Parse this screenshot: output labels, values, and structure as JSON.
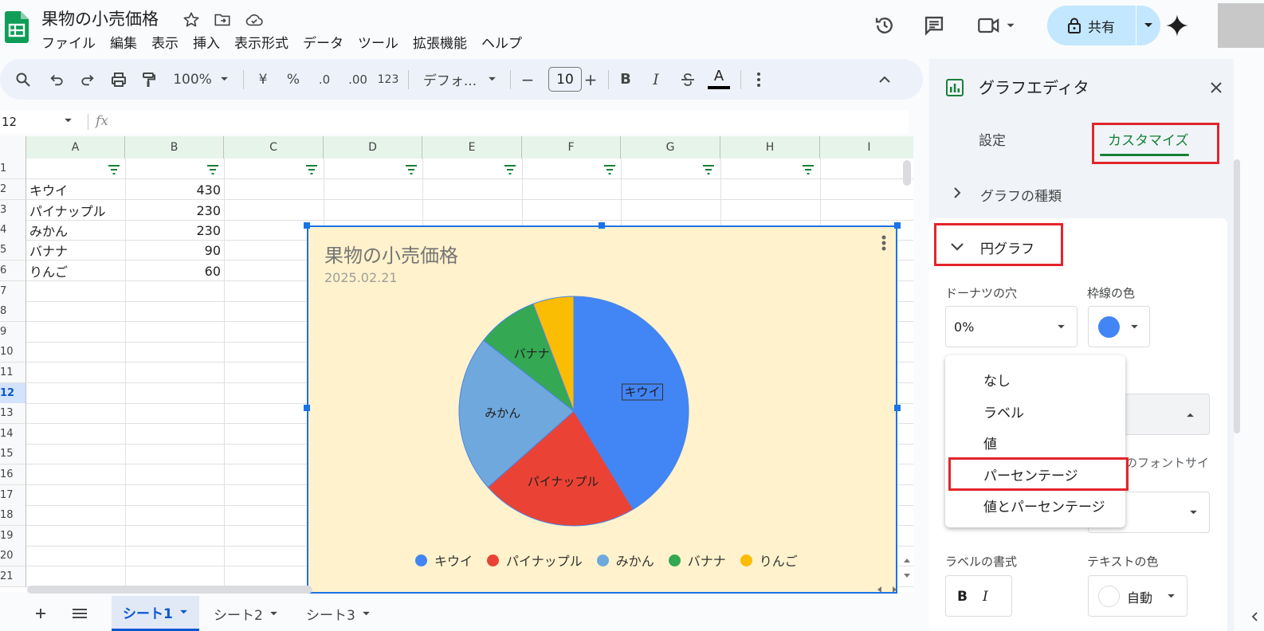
{
  "app": {
    "doc_title": "果物の小売価格",
    "menu": [
      "ファイル",
      "編集",
      "表示",
      "挿入",
      "表示形式",
      "データ",
      "ツール",
      "拡張機能",
      "ヘルプ"
    ],
    "share_label": "共有"
  },
  "toolbar": {
    "zoom": "100%",
    "currency": "¥",
    "percent": "%",
    "dec_decrease": ".0",
    "dec_increase": ".00",
    "number_format": "123",
    "font": "デフォ...",
    "font_size": "10",
    "minus": "−",
    "plus": "+",
    "bold": "B",
    "italic": "I",
    "text_color": "A"
  },
  "formula_bar": {
    "name_box": "12",
    "fx": "fx"
  },
  "sheet": {
    "columns": [
      "A",
      "B",
      "C",
      "D",
      "E",
      "F",
      "G",
      "H",
      "I"
    ],
    "rows": [
      "1",
      "2",
      "3",
      "4",
      "5",
      "6",
      "7",
      "8",
      "9",
      "10",
      "11",
      "12",
      "13",
      "14",
      "15",
      "16",
      "17",
      "18",
      "19",
      "20",
      "21"
    ],
    "selected_row": "12",
    "data": [
      {
        "name": "キウイ",
        "value": "430"
      },
      {
        "name": "パイナップル",
        "value": "230"
      },
      {
        "name": "みかん",
        "value": "230"
      },
      {
        "name": "バナナ",
        "value": "90"
      },
      {
        "name": "りんご",
        "value": "60"
      }
    ]
  },
  "chart_data": {
    "type": "pie",
    "title": "果物の小売価格",
    "subtitle": "2025.02.21",
    "categories": [
      "キウイ",
      "パイナップル",
      "みかん",
      "バナナ",
      "りんご"
    ],
    "values": [
      430,
      230,
      230,
      90,
      60
    ],
    "colors": [
      "#4285f4",
      "#ea4335",
      "#6fa8dc",
      "#34a853",
      "#fbbc04"
    ],
    "slice_labels": [
      "キウイ",
      "パイナップル",
      "みかん",
      "バナナ",
      ""
    ],
    "legend_position": "bottom",
    "background": "#fff2cc",
    "border_color": "#4a86e8"
  },
  "sheet_tabs": [
    "シート1",
    "シート2",
    "シート3"
  ],
  "panel": {
    "title": "グラフエディタ",
    "tabs": [
      "設定",
      "カスタマイズ"
    ],
    "active_tab": "カスタマイズ",
    "section_chart_type": "グラフの種類",
    "section_pie": "円グラフ",
    "donut_label": "ドーナツの穴",
    "donut_value": "0%",
    "border_color_label": "枠線の色",
    "font_size_partial": "のフォントサイ",
    "label_format": "ラベルの書式",
    "text_color": "テキストの色",
    "auto_value": "自動",
    "bold": "B",
    "italic": "I",
    "dropdown_options": [
      "なし",
      "ラベル",
      "値",
      "パーセンテージ",
      "値とパーセンテージ"
    ],
    "highlighted_option": "パーセンテージ"
  },
  "colors": {
    "accent": "#0b57d0",
    "sheets_green": "#188038",
    "highlight_red": "#e2252b",
    "border_swatch": "#4285f4"
  }
}
